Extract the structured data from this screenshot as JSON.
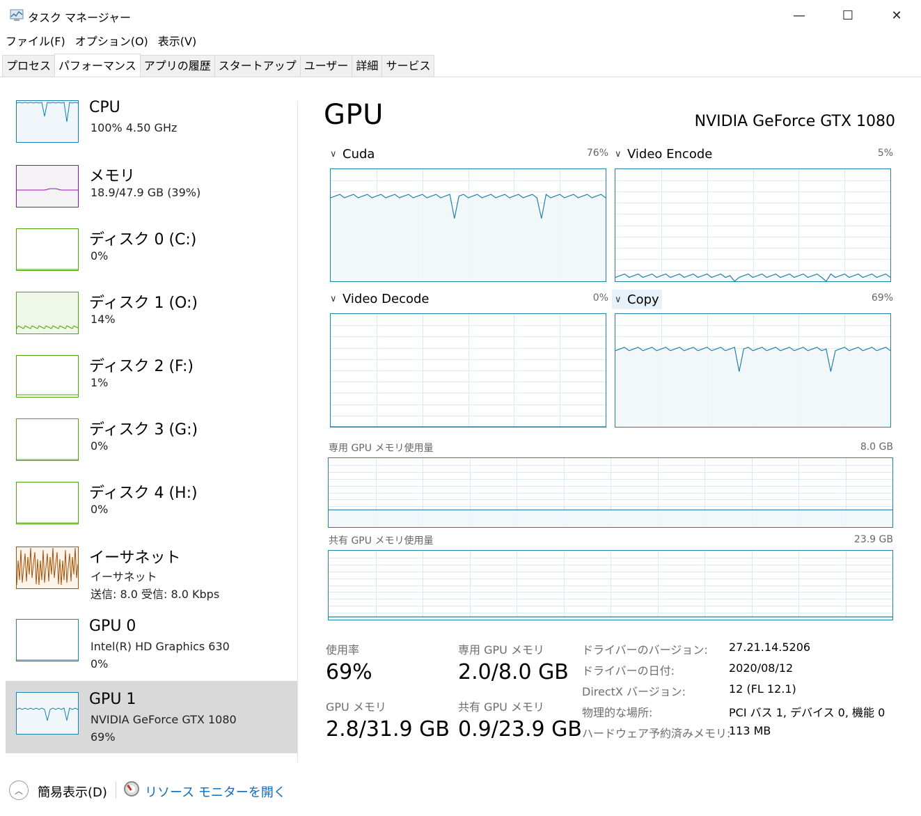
{
  "window": {
    "title": "タスク マネージャー",
    "minimize_glyph": "—",
    "maximize_glyph": "☐",
    "close_glyph": "✕"
  },
  "menu": [
    "ファイル(F)",
    "オプション(O)",
    "表示(V)"
  ],
  "tabs": [
    "プロセス",
    "パフォーマンス",
    "アプリの履歴",
    "スタートアップ",
    "ユーザー",
    "詳細",
    "サービス"
  ],
  "active_tab": "パフォーマンス",
  "sidebar": {
    "items": [
      {
        "title": "CPU",
        "line1": "100%  4.50 GHz",
        "line2": "",
        "color": "#117dbb",
        "fill": "#f1f6fa"
      },
      {
        "title": "メモリ",
        "line1": "18.9/47.9 GB (39%)",
        "line2": "",
        "color": "#8b12ae",
        "fill": "#f4f2f4"
      },
      {
        "title": "ディスク 0 (C:)",
        "line1": "0%",
        "line2": "",
        "color": "#4da60c",
        "fill": "#ffffff"
      },
      {
        "title": "ディスク 1 (O:)",
        "line1": "14%",
        "line2": "",
        "color": "#4da60c",
        "fill": "#eff7e8"
      },
      {
        "title": "ディスク 2 (F:)",
        "line1": "1%",
        "line2": "",
        "color": "#4da60c",
        "fill": "#ffffff"
      },
      {
        "title": "ディスク 3 (G:)",
        "line1": "0%",
        "line2": "",
        "color": "#4da60c",
        "fill": "#ffffff"
      },
      {
        "title": "ディスク 4 (H:)",
        "line1": "0%",
        "line2": "",
        "color": "#4da60c",
        "fill": "#ffffff"
      },
      {
        "title": "イーサネット",
        "line1": "イーサネット",
        "line2": "送信: 8.0  受信: 8.0 Kbps",
        "color": "#a74f01",
        "fill": "#fcf3eb"
      },
      {
        "title": "GPU 0",
        "line1": "Intel(R) HD Graphics 630",
        "line2": "0%",
        "color": "#1f82a8",
        "fill": "#ffffff"
      },
      {
        "title": "GPU 1",
        "line1": "NVIDIA GeForce GTX 1080",
        "line2": "69%",
        "color": "#1f82a8",
        "fill": "#f1f6fa"
      }
    ],
    "selected_index": 9
  },
  "main": {
    "title": "GPU",
    "model": "NVIDIA GeForce GTX 1080",
    "engines": [
      {
        "name": "Cuda",
        "percent": "76%",
        "value": 0.76
      },
      {
        "name": "Video Encode",
        "percent": "5%",
        "value": 0.05
      },
      {
        "name": "Video Decode",
        "percent": "0%",
        "value": 0.0
      },
      {
        "name": "Copy",
        "percent": "69%",
        "value": 0.69
      }
    ],
    "dedicated_mem": {
      "label": "専用 GPU メモリ使用量",
      "capacity": "8.0 GB",
      "value": 0.25
    },
    "shared_mem": {
      "label": "共有 GPU メモリ使用量",
      "capacity": "23.9 GB",
      "value": 0.04
    },
    "stats": {
      "usage_label": "使用率",
      "usage_value": "69%",
      "dedicated_label": "専用 GPU メモリ",
      "dedicated_value": "2.0/8.0 GB",
      "gpu_mem_label": "GPU メモリ",
      "gpu_mem_value": "2.8/31.9 GB",
      "shared_label": "共有 GPU メモリ",
      "shared_value": "0.9/23.9 GB"
    },
    "info": [
      {
        "key": "ドライバーのバージョン:",
        "value": "27.21.14.5206"
      },
      {
        "key": "ドライバーの日付:",
        "value": "2020/08/12"
      },
      {
        "key": "DirectX バージョン:",
        "value": "12 (FL 12.1)"
      },
      {
        "key": "物理的な場所:",
        "value": "PCI バス 1, デバイス 0, 機能 0"
      },
      {
        "key": "ハードウェア予約済みメモリ:",
        "value": "113 MB"
      }
    ]
  },
  "footer": {
    "fewer_details": "簡易表示(D)",
    "resource_monitor": "リソース モニターを開く"
  },
  "icons": [
    "task-manager-icon",
    "chevron-up-icon",
    "resource-monitor-icon",
    "chevron-down-icon"
  ]
}
